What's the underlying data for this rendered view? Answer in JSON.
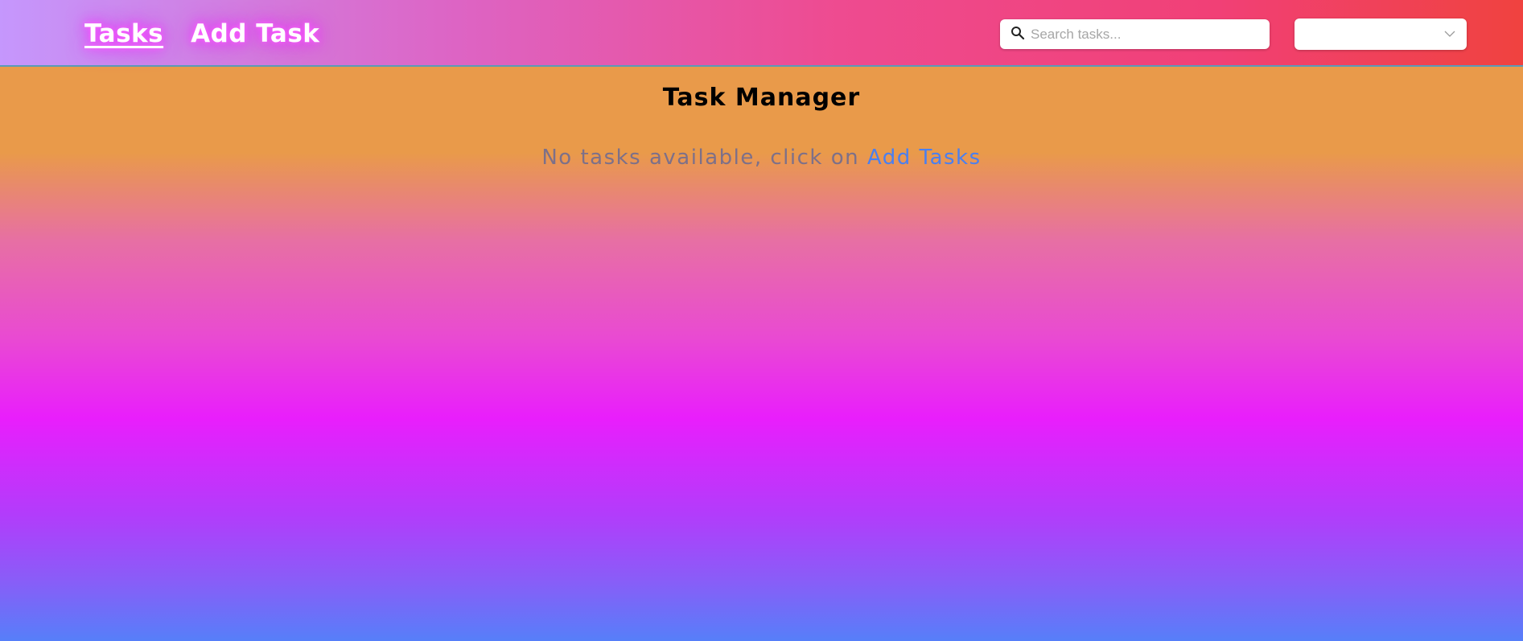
{
  "nav": {
    "links": [
      {
        "label": "Tasks",
        "active": true
      },
      {
        "label": "Add Task",
        "active": false
      }
    ]
  },
  "search": {
    "placeholder": "Search tasks...",
    "value": ""
  },
  "filter": {
    "selected": ""
  },
  "main": {
    "title": "Task Manager",
    "empty_message": "No tasks available, click on",
    "add_tasks_link": "Add Tasks"
  },
  "icons": {
    "search": "search-icon",
    "dropdown": "chevron-down-icon"
  },
  "colors": {
    "link_accent": "#4a7ff0",
    "nav_glow": "#f040ff",
    "title": "#000000",
    "empty_text": "#7d7089"
  }
}
